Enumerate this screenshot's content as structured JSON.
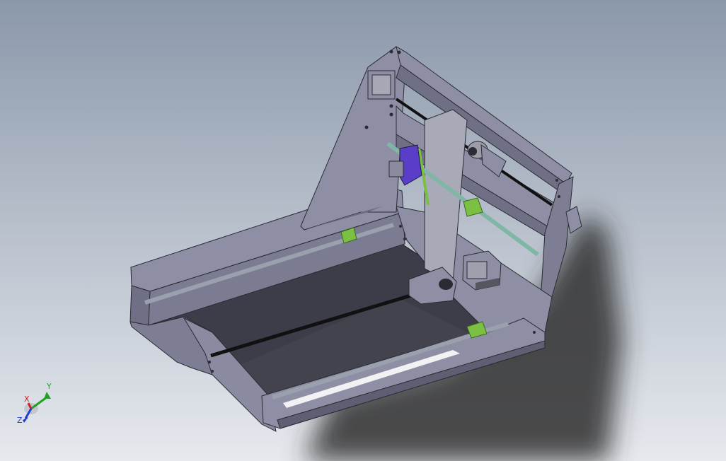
{
  "viewport": {
    "background_top": "#8b98aa",
    "background_bottom": "#e6e9ee"
  },
  "colors": {
    "frame_light": "#8e8fa4",
    "frame_mid": "#777890",
    "frame_dark": "#4b4c5a",
    "edge": "#2a2a33",
    "bed_dark": "#3c3d48",
    "rod": "#9aa0ad",
    "lead_screw": "#111111",
    "bracket_green": "#7cc043",
    "teal_rod": "#7fb6a6",
    "blue_part": "#5b3ec8",
    "shadow": "#3a3a3a"
  },
  "triad": {
    "x_label": "X",
    "y_label": "Y",
    "z_label": "Z",
    "x_color": "#d22020",
    "y_color": "#1fa31f",
    "z_color": "#1f3fd2"
  }
}
